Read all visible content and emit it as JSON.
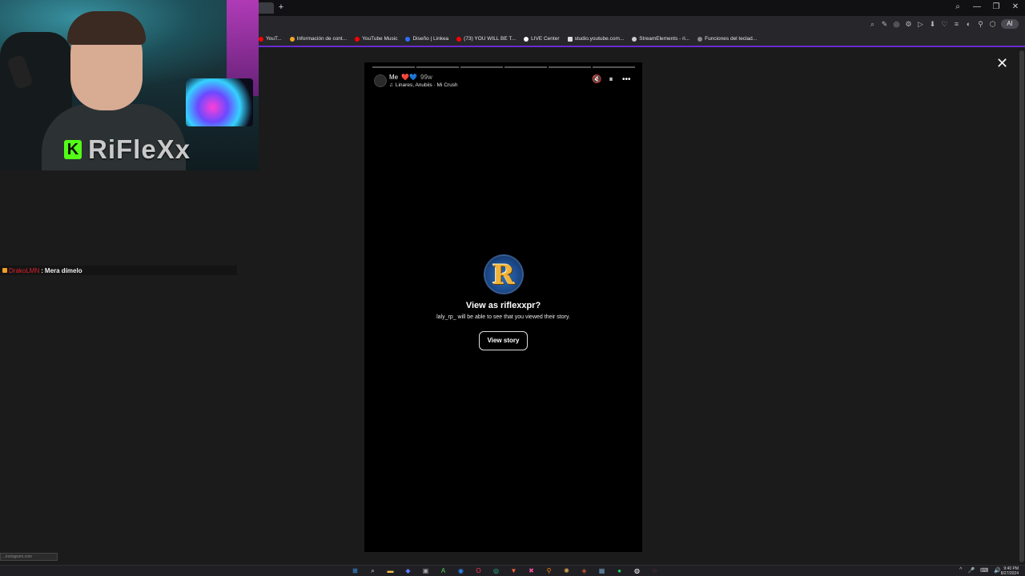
{
  "browser": {
    "new_tab_symbol": "+",
    "window_controls": [
      "⌕",
      "—",
      "❐",
      "✕"
    ],
    "toolbar_icons": [
      "⌕",
      "✎",
      "◎",
      "⚙",
      "▷",
      "⬇",
      "♡",
      "≡",
      "◐",
      "⚲",
      "⬡"
    ],
    "toolbar_pill": "AI",
    "bookmarks": [
      {
        "label": "YouT...",
        "color": "#ff0000"
      },
      {
        "label": "Información de cont...",
        "color": "#f5a623"
      },
      {
        "label": "YouTube Music",
        "color": "#ff0000"
      },
      {
        "label": "Diseño | Linkea",
        "color": "#2f6fff"
      },
      {
        "label": "(73) YOU WILL BE T...",
        "color": "#ff0000"
      },
      {
        "label": "LIVE Center",
        "color": "#ffffff"
      },
      {
        "label": "studio.youtube.com...",
        "color": "#dddddd"
      },
      {
        "label": "StreamElements - ri...",
        "color": "#cccccc"
      },
      {
        "label": "Funciones del teclad...",
        "color": "#888888"
      }
    ]
  },
  "webcam": {
    "brand_letter": "K",
    "streamer_name": "RiFleXx"
  },
  "chat": {
    "username": "DrakoLMN",
    "separator": " : ",
    "message": "Mera dímelo"
  },
  "story": {
    "close_symbol": "✕",
    "segments": 6,
    "user": "Me",
    "hearts": "❤️💙",
    "age": "99w",
    "song": "Linares, Anubiis · Mi Crush",
    "controls": {
      "mute": "🔇",
      "pause": "⏸",
      "more": "•••"
    },
    "prompt": {
      "logo_letter": "R",
      "title": "View as riflexxpr?",
      "description": "laly_rp_ will be able to see that you viewed their story.",
      "button": "View story"
    }
  },
  "status_bar": {
    "url_hint": "...instagram.com"
  },
  "taskbar": {
    "icons": [
      {
        "name": "windows",
        "glyph": "⊞",
        "color": "#3aa0ff"
      },
      {
        "name": "search",
        "glyph": "⌕",
        "color": "#dddddd"
      },
      {
        "name": "files",
        "glyph": "▬",
        "color": "#f2c14e"
      },
      {
        "name": "chat",
        "glyph": "◆",
        "color": "#5b7cff"
      },
      {
        "name": "terminal",
        "glyph": "▣",
        "color": "#aaaaaa"
      },
      {
        "name": "app-green",
        "glyph": "A",
        "color": "#57d35b"
      },
      {
        "name": "app-blue",
        "glyph": "◉",
        "color": "#2f8bff"
      },
      {
        "name": "opera",
        "glyph": "O",
        "color": "#ff3355"
      },
      {
        "name": "edge",
        "glyph": "◎",
        "color": "#2ac3a2"
      },
      {
        "name": "brave",
        "glyph": "▼",
        "color": "#ff6633"
      },
      {
        "name": "app-pink",
        "glyph": "✖",
        "color": "#ff4fa3"
      },
      {
        "name": "app-orange",
        "glyph": "⚲",
        "color": "#ff8a00"
      },
      {
        "name": "app-gear",
        "glyph": "✺",
        "color": "#d9a54a"
      },
      {
        "name": "app-dark",
        "glyph": "◈",
        "color": "#cc5533"
      },
      {
        "name": "app-mid",
        "glyph": "▦",
        "color": "#6f9fbf"
      },
      {
        "name": "spotify",
        "glyph": "●",
        "color": "#1ed760"
      },
      {
        "name": "obs",
        "glyph": "◍",
        "color": "#ffffff"
      },
      {
        "name": "app-red",
        "glyph": "◌",
        "color": "#ff5555"
      }
    ],
    "tray": [
      "^",
      "🎤",
      "⌨",
      "🔊"
    ],
    "time": "9:40 PM",
    "date": "8/27/2024"
  }
}
